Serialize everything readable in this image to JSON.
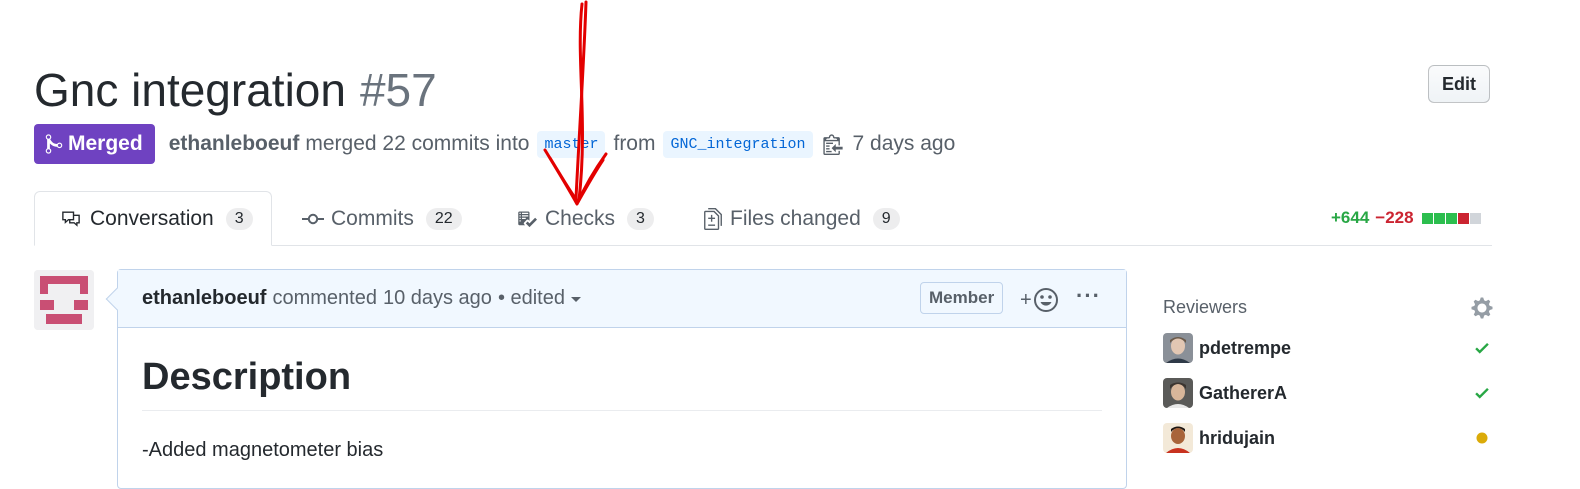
{
  "pr": {
    "title": "Gnc integration",
    "number": "#57",
    "edit_label": "Edit",
    "state_label": "Merged",
    "author": "ethanleboeuf",
    "merge_text": "merged 22 commits into",
    "base_branch": "master",
    "from_text": "from",
    "head_branch": "GNC_integration",
    "time_ago": "7 days ago"
  },
  "tabs": [
    {
      "label": "Conversation",
      "count": "3"
    },
    {
      "label": "Commits",
      "count": "22"
    },
    {
      "label": "Checks",
      "count": "3"
    },
    {
      "label": "Files changed",
      "count": "9"
    }
  ],
  "diffstat": {
    "additions": "+644",
    "deletions": "−228",
    "blocks": [
      "#2cbe4e",
      "#2cbe4e",
      "#2cbe4e",
      "#cb2431",
      "#d1d5da"
    ]
  },
  "comment": {
    "author": "ethanleboeuf",
    "action": "commented",
    "time_ago": "10 days ago",
    "edited": "• edited",
    "role_badge": "Member",
    "react_plus": "+",
    "more": "···",
    "heading": "Description",
    "body_line": "-Added magnetometer bias"
  },
  "sidebar": {
    "title": "Reviewers",
    "reviewers": [
      {
        "name": "pdetrempe",
        "status": "approved"
      },
      {
        "name": "GathererA",
        "status": "approved"
      },
      {
        "name": "hridujain",
        "status": "pending"
      }
    ]
  },
  "colors": {
    "merged": "#6f42c1",
    "approved": "#28a745",
    "pending": "#dbab09",
    "annotation": "#e30000"
  }
}
